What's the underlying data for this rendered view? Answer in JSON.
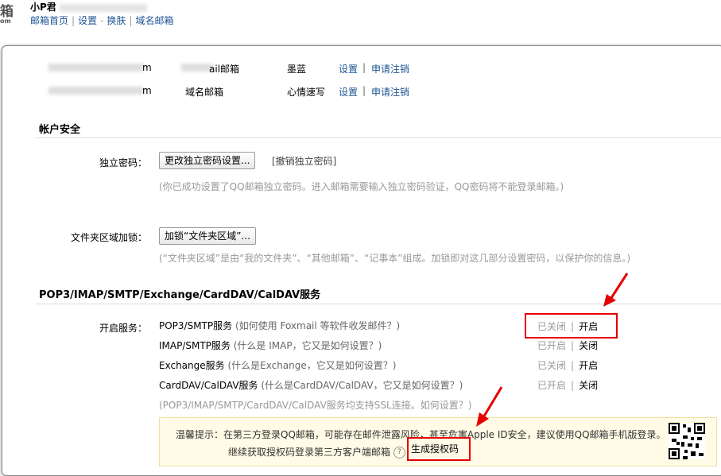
{
  "brand": {
    "char": "箱",
    "suffix": "om"
  },
  "user": {
    "name": "小P君"
  },
  "topnav": {
    "home": "邮箱首页",
    "settings": "设置",
    "skin": "换肤",
    "domain": "域名邮箱"
  },
  "accounts": [
    {
      "addr_suffix": "m",
      "type": "ail邮箱",
      "skin": "墨蓝",
      "set": "设置",
      "cancel": "申请注销"
    },
    {
      "addr_suffix": "m",
      "type": "域名邮箱",
      "skin": "心情速写",
      "set": "设置",
      "cancel": "申请注销"
    }
  ],
  "security": {
    "title": "帐户安全",
    "pwd_label": "独立密码：",
    "pwd_button": "更改独立密码设置...",
    "pwd_cancel": "[撤销独立密码]",
    "pwd_hint": "(你已成功设置了QQ邮箱独立密码。进入邮箱需要输入独立密码验证，QQ密码将不能登录邮箱。)",
    "lock_label": "文件夹区域加锁：",
    "lock_button": "加锁“文件夹区域”...",
    "lock_hint": "(“文件夹区域”是由“我的文件夹”、“其他邮箱”、“记事本”组成。加锁即对这几部分设置密码，以保护你的信息。)"
  },
  "services": {
    "title": "POP3/IMAP/SMTP/Exchange/CardDAV/CalDAV服务",
    "label": "开启服务：",
    "items": [
      {
        "name": "POP3/SMTP服务",
        "question": "(如何使用 Foxmail 等软件收发邮件？)",
        "off": "已关闭",
        "on": "开启"
      },
      {
        "name": "IMAP/SMTP服务",
        "question": "(什么是 IMAP，它又是如何设置？)",
        "off": "已开启",
        "on": "关闭"
      },
      {
        "name": "Exchange服务",
        "question": "(什么是Exchange，它又是如何设置？)",
        "off": "已关闭",
        "on": "开启"
      },
      {
        "name": "CardDAV/CalDAV服务",
        "question": "(什么是CardDAV/CalDAV，它又是如何设置？)",
        "off": "已开启",
        "on": "关闭"
      }
    ],
    "ssl_hint": "(POP3/IMAP/SMTP/CardDAV/CalDAV服务均支持SSL连接。如何设置？)"
  },
  "tip": {
    "line1": "温馨提示：在第三方登录QQ邮箱，可能存在邮件泄露风险，甚至危害Apple ID安全，建议使用QQ邮箱手机版登录。",
    "line2": "继续获取授权码登录第三方客户端邮箱",
    "qmark": "?",
    "generate": "生成授权码"
  },
  "colors": {
    "accent": "#1e5494",
    "highlight": "#e60000",
    "tip_bg": "#fffbe6"
  },
  "icons": {
    "qr": "qr-code-icon",
    "arrow": "red-arrow-icon"
  }
}
